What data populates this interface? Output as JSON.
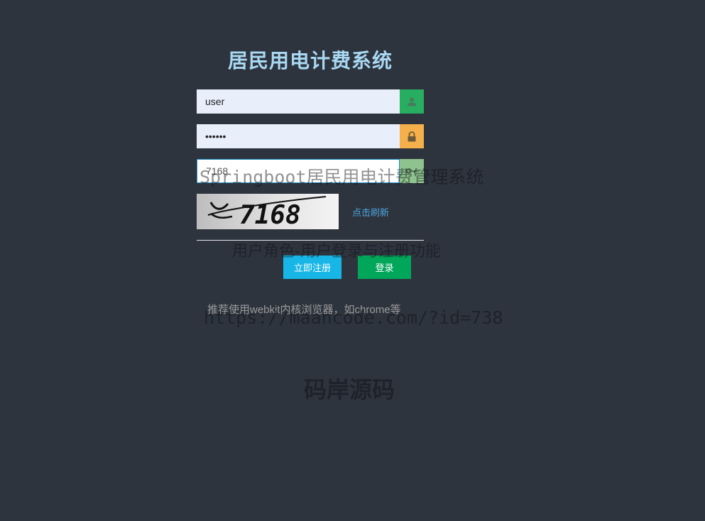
{
  "login": {
    "title": "居民用电计费系统",
    "username": {
      "value": "user",
      "icon": "user-icon",
      "icon_color": "#27ae60"
    },
    "password": {
      "value": "••••••",
      "icon": "lock-icon",
      "icon_color": "#f5b04b"
    },
    "captcha_input": {
      "value": "7168",
      "icon": "key-icon",
      "icon_color": "#8ec28e"
    },
    "captcha_image_text": "7168",
    "refresh_label": "点击刷新",
    "register_label": "立即注册",
    "login_label": "登录",
    "browser_hint": "推荐使用webkit内核浏览器，如chrome等"
  },
  "watermark": {
    "line1": "Springboot居民用电计费管理系统",
    "line2": "用户角色-用户登录与注册功能",
    "line3": "https://maancode.com/?id=738",
    "line4": "码岸源码"
  },
  "colors": {
    "background": "#2e343e",
    "title": "#a9d8f2",
    "register_button": "#17b6e6",
    "login_button": "#00a65a",
    "link": "#4aa6e0"
  }
}
